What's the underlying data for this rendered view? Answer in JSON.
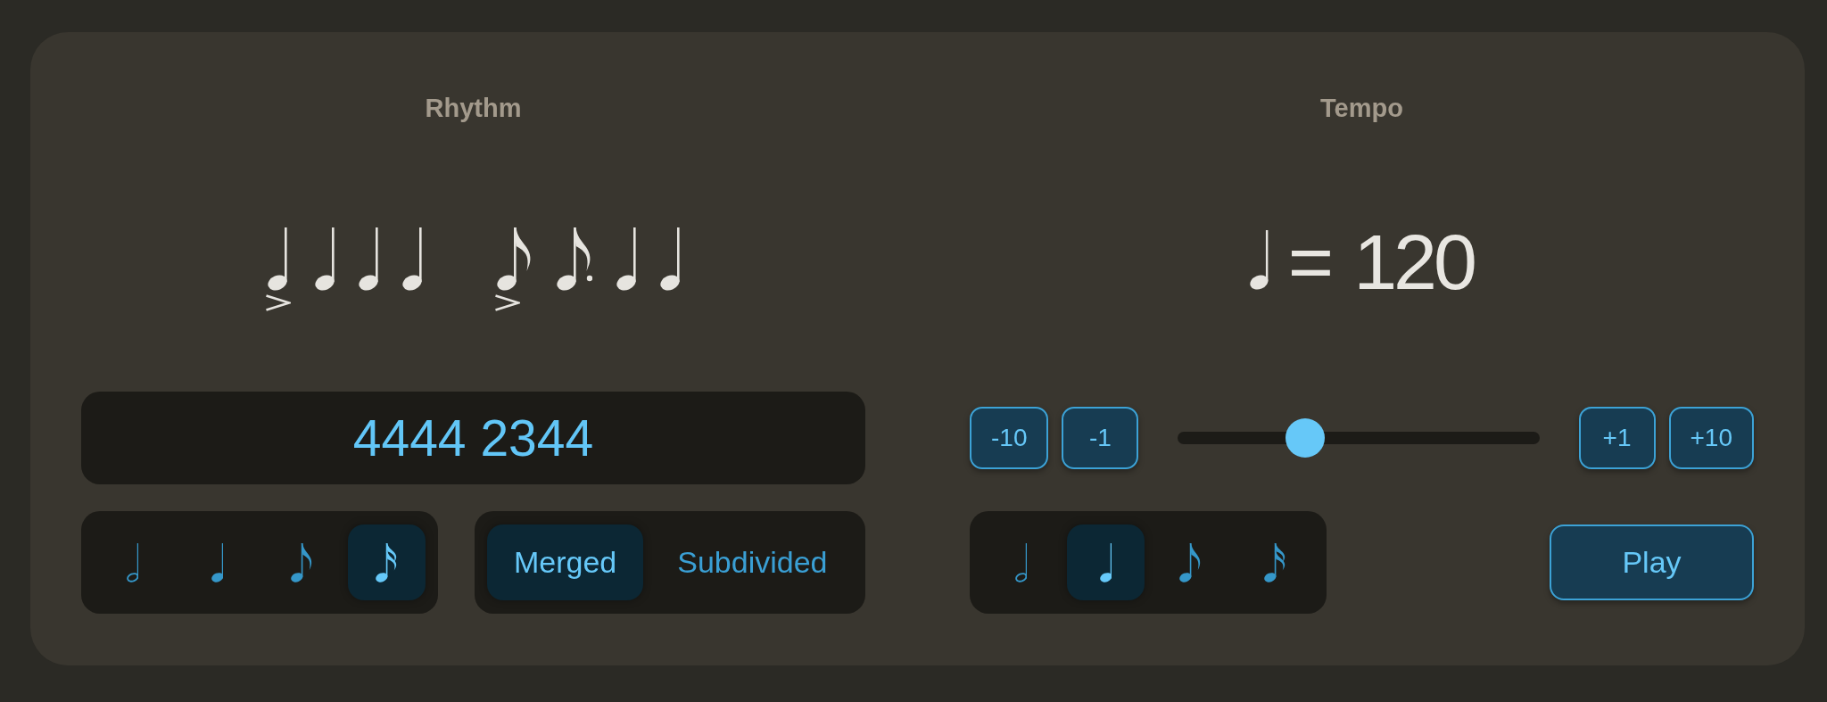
{
  "rhythm": {
    "title": "Rhythm",
    "notation": {
      "groups": [
        {
          "notes": [
            {
              "kind": "quarter",
              "accent": true
            },
            {
              "kind": "quarter",
              "accent": false
            },
            {
              "kind": "quarter",
              "accent": false
            },
            {
              "kind": "quarter",
              "accent": false
            }
          ]
        },
        {
          "notes": [
            {
              "kind": "eighth",
              "accent": true
            },
            {
              "kind": "dotted_eighth",
              "accent": false
            },
            {
              "kind": "quarter",
              "accent": false
            },
            {
              "kind": "quarter",
              "accent": false
            }
          ]
        }
      ]
    },
    "pattern_field": {
      "value": "4444 2344"
    },
    "note_values": [
      {
        "kind": "half",
        "selected": false
      },
      {
        "kind": "quarter",
        "selected": false
      },
      {
        "kind": "eighth",
        "selected": false
      },
      {
        "kind": "sixteenth",
        "selected": true
      }
    ],
    "display_modes": [
      {
        "label": "Merged",
        "selected": true
      },
      {
        "label": "Subdivided",
        "selected": false
      }
    ]
  },
  "tempo": {
    "title": "Tempo",
    "marking": {
      "kind": "quarter",
      "equals": "=",
      "bpm": "120"
    },
    "decrease_buttons": [
      {
        "label": "-10"
      },
      {
        "label": "-1"
      }
    ],
    "slider": {
      "level": 0.333
    },
    "increase_buttons": [
      {
        "label": "+1"
      },
      {
        "label": "+10"
      }
    ],
    "beat_units": [
      {
        "kind": "half",
        "selected": false
      },
      {
        "kind": "quarter",
        "selected": true
      },
      {
        "kind": "eighth",
        "selected": false
      },
      {
        "kind": "sixteenth",
        "selected": false
      }
    ],
    "play_button": {
      "label": "Play"
    }
  }
}
